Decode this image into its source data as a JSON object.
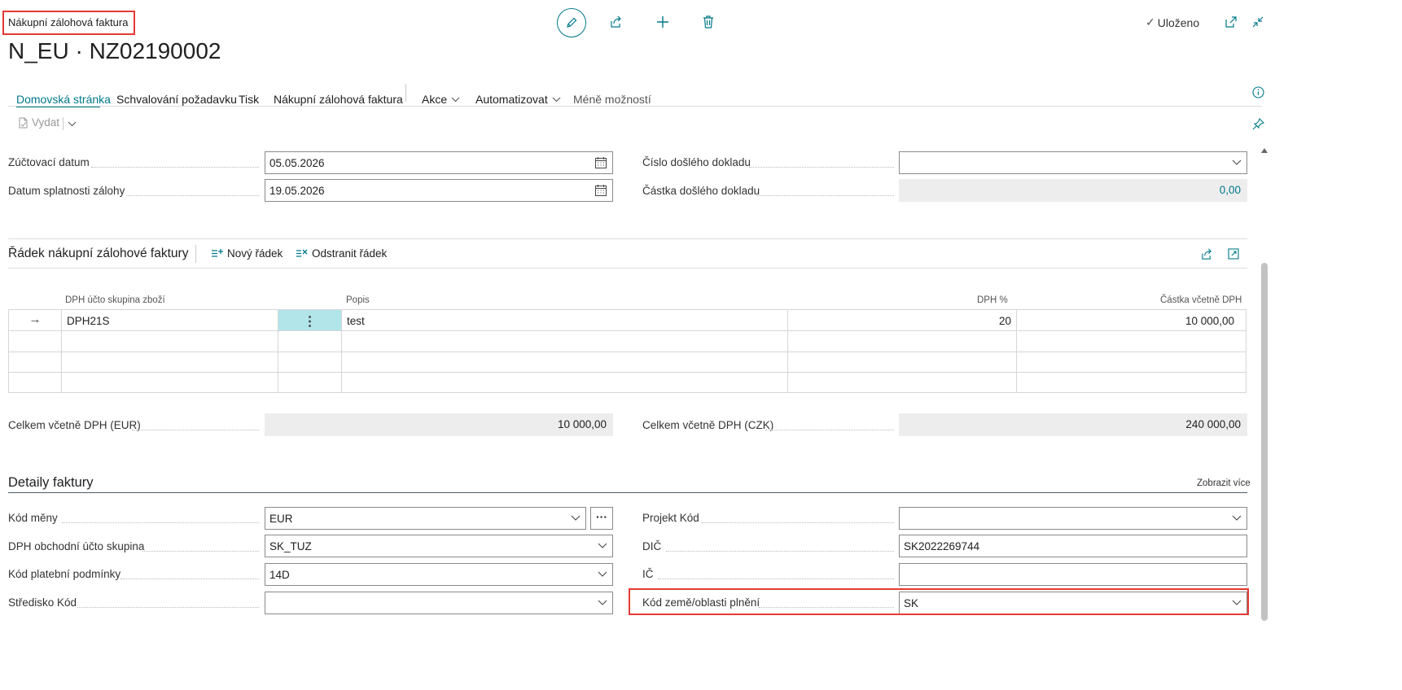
{
  "header": {
    "caption": "Nákupní zálohová faktura",
    "title": "N_EU · NZ02190002",
    "saved_label": "Uloženo"
  },
  "nav": {
    "items": [
      "Domovská stránka",
      "Schvalování požadavku",
      "Tisk",
      "Nákupní zálohová faktura"
    ],
    "actions_label": "Akce",
    "automate_label": "Automatizovat",
    "fewer_label": "Méně možností"
  },
  "toolbar": {
    "release_label": "Vydat"
  },
  "general": {
    "posting_date_label": "Zúčtovací datum",
    "posting_date": "05.05.2026",
    "due_date_label": "Datum splatnosti zálohy",
    "due_date": "19.05.2026",
    "vendor_doc_no_label": "Číslo došlého dokladu",
    "vendor_doc_no": "",
    "vendor_doc_amount_label": "Částka došlého dokladu",
    "vendor_doc_amount": "0,00"
  },
  "lines": {
    "title": "Řádek nákupní zálohové faktury",
    "new_line_label": "Nový řádek",
    "delete_line_label": "Odstranit řádek",
    "columns": [
      "DPH účto skupina zboží",
      "Popis",
      "DPH %",
      "Částka včetně DPH"
    ],
    "rows": [
      {
        "group": "DPH21S",
        "description": "test",
        "vat_pct": "20",
        "amount": "10 000,00"
      }
    ]
  },
  "totals": {
    "eur_label": "Celkem včetně DPH (EUR)",
    "eur_value": "10 000,00",
    "czk_label": "Celkem včetně DPH (CZK)",
    "czk_value": "240 000,00"
  },
  "details": {
    "title": "Detaily faktury",
    "show_more": "Zobrazit více",
    "currency_label": "Kód měny",
    "currency": "EUR",
    "vat_bus_group_label": "DPH obchodní účto skupina",
    "vat_bus_group": "SK_TUZ",
    "payment_terms_label": "Kód platební podmínky",
    "payment_terms": "14D",
    "cost_center_label": "Středisko Kód",
    "cost_center": "",
    "project_label": "Projekt Kód",
    "project": "",
    "vat_reg_label": "DIČ",
    "vat_reg": "SK2022269744",
    "reg_no_label": "IČ",
    "reg_no": "",
    "country_label": "Kód země/oblasti plnění",
    "country": "SK"
  },
  "colors": {
    "accent": "#00788a",
    "highlight": "#e53935",
    "selected_cell": "#b2e5ea"
  }
}
